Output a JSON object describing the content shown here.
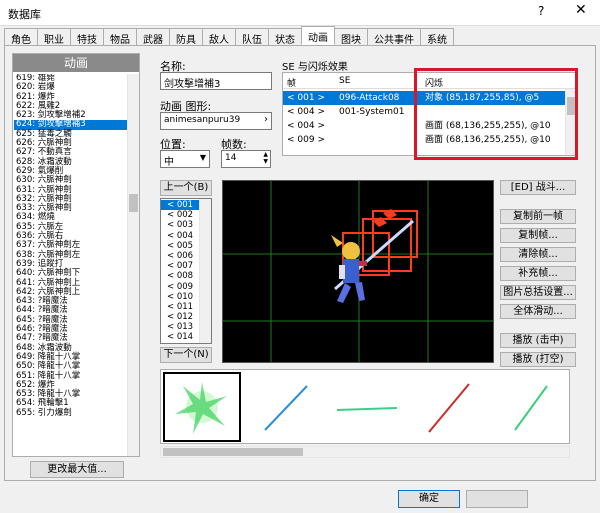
{
  "window": {
    "title": "数据库",
    "help": "?",
    "close": "✕"
  },
  "tabs": [
    "角色",
    "职业",
    "特技",
    "物品",
    "武器",
    "防具",
    "敌人",
    "队伍",
    "状态",
    "动画",
    "图块",
    "公共事件",
    "系统"
  ],
  "active_tab": 9,
  "animation_list": {
    "header": "动画",
    "items": [
      "619: 雄毙",
      "620: 岩爆",
      "621: 爆炸",
      "622: 風雞2",
      "623: 剑攻擊增補2",
      "624: 剑攻擊增補3",
      "625: 猛毒之觸",
      "626: 六脈神劍",
      "627: 不動真言",
      "628: 冰霜波動",
      "629: 氣爆削",
      "630: 六脈神劍",
      "631: 六脈神劍",
      "632: 六脈神劍",
      "633: 六脈神劍",
      "634: 燃燒",
      "635: 六脈左",
      "636: 六脈右",
      "637: 六脈神劍左",
      "638: 六脈神劍左",
      "639: 追蹤打",
      "640: 六脈神劍下",
      "641: 六脈神劍上",
      "642: 六脈神劍上",
      "643: ?暗魔法",
      "644: ?暗魔法",
      "645: ?暗魔法",
      "646: ?暗魔法",
      "647: ?暗魔法",
      "648: 冰霜波動",
      "649: 降龍十八掌",
      "650: 降龍十八掌",
      "651: 降龍十八掌",
      "652: 爆炸",
      "653: 降龍十八掌",
      "654: 飛輪擊1",
      "655: 引力爆劍"
    ],
    "selected_index": 5,
    "change_max_button": "更改最大值..."
  },
  "properties": {
    "name_label": "名称:",
    "name_value": "剑攻擊增補3",
    "graphic_label": "动画 图形:",
    "graphic_value": "animesanpuru39",
    "position_label": "位置:",
    "position_value": "中",
    "frames_label": "帧数:",
    "frames_value": "14"
  },
  "se_flash": {
    "title": "SE 与闪烁效果",
    "columns": [
      "帧",
      "SE",
      "闪烁"
    ],
    "rows": [
      {
        "frame": "< 001 >",
        "se": "096-Attack08",
        "flash": "对象 (85,187,255,85), @5",
        "selected": true
      },
      {
        "frame": "< 004 >",
        "se": "001-System01",
        "flash": "",
        "selected": false
      },
      {
        "frame": "< 004 >",
        "se": "",
        "flash": "画面 (68,136,255,255), @10",
        "selected": false
      },
      {
        "frame": "< 009 >",
        "se": "",
        "flash": "画面 (68,136,255,255), @10",
        "selected": false
      }
    ]
  },
  "frames": {
    "prev_button": "上一个(B)",
    "next_button": "下一个(N)",
    "items": [
      "< 001",
      "< 002",
      "< 003",
      "< 004",
      "< 005",
      "< 006",
      "< 007",
      "< 008",
      "< 009",
      "< 010",
      "< 011",
      "< 012",
      "< 013",
      "< 014"
    ],
    "selected_index": 0
  },
  "right_buttons": [
    "[ED] 战斗...",
    "复制前一帧",
    "复制帧...",
    "清除帧...",
    "补充帧...",
    "图片总括设置...",
    "全体滑动...",
    "播放 (击中)",
    "播放 (打空)"
  ],
  "footer": {
    "ok": "确定",
    "cancel": ""
  },
  "colors": {
    "highlight": "#d7182a",
    "selection": "#0078d7",
    "stage_bg": "#000000"
  }
}
